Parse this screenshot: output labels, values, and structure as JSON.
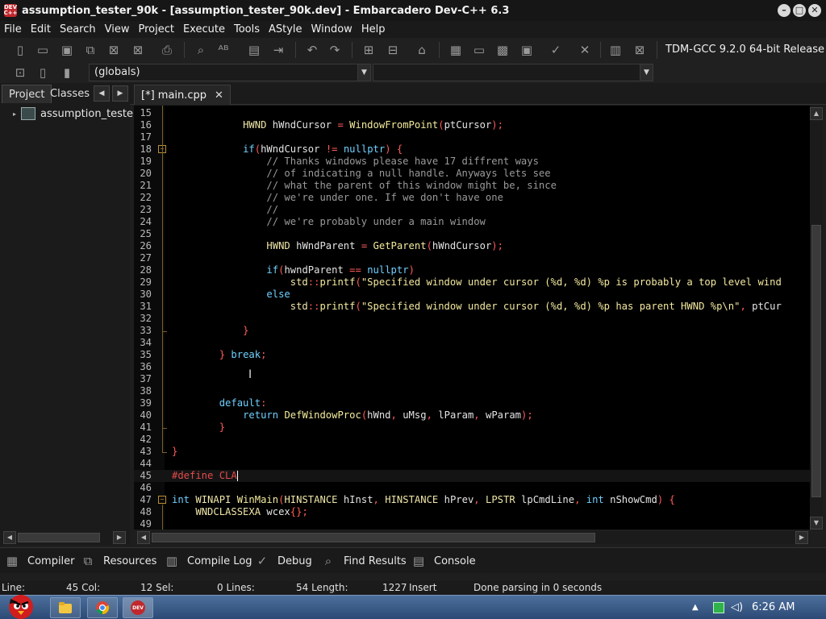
{
  "window": {
    "title": "assumption_tester_90k - [assumption_tester_90k.dev] - Embarcadero Dev-C++ 6.3",
    "app_icon_text": "DEV C++"
  },
  "menu": [
    "File",
    "Edit",
    "Search",
    "View",
    "Project",
    "Execute",
    "Tools",
    "AStyle",
    "Window",
    "Help"
  ],
  "toolbar": {
    "compiler": "TDM-GCC 9.2.0 64-bit Release",
    "scope_combo": "(globals)"
  },
  "left_panel": {
    "tabs": [
      "Project",
      "Classes"
    ],
    "active_tab": "Project",
    "tree_root": "assumption_tester"
  },
  "editor": {
    "tab_label": "[*] main.cpp",
    "close_glyph": "✕",
    "lines": [
      {
        "n": "15",
        "html": ""
      },
      {
        "n": "16",
        "html": "            <span class=\"t\">HWND</span> <span class=\"id\">hWndCursor</span> <span class=\"o\">=</span> <span class=\"f\">WindowFromPoint</span><span class=\"o\">(</span><span class=\"id\">ptCursor</span><span class=\"o\">);</span>"
      },
      {
        "n": "17",
        "html": ""
      },
      {
        "n": "18",
        "html": "            <span class=\"k\">if</span><span class=\"o\">(</span><span class=\"id\">hWndCursor</span> <span class=\"o\">!=</span> <span class=\"k\">nullptr</span><span class=\"o\">)</span> <span class=\"o\">{</span>"
      },
      {
        "n": "19",
        "html": "                <span class=\"c\">// Thanks windows please have 17 diffrent ways</span>"
      },
      {
        "n": "20",
        "html": "                <span class=\"c\">// of indicating a null handle. Anyways lets see</span>"
      },
      {
        "n": "21",
        "html": "                <span class=\"c\">// what the parent of this window might be, since</span>"
      },
      {
        "n": "22",
        "html": "                <span class=\"c\">// we're under one. If we don't have one</span>"
      },
      {
        "n": "23",
        "html": "                <span class=\"c\">//</span>"
      },
      {
        "n": "24",
        "html": "                <span class=\"c\">// we're probably under a main window</span>"
      },
      {
        "n": "25",
        "html": ""
      },
      {
        "n": "26",
        "html": "                <span class=\"t\">HWND</span> <span class=\"id\">hWndParent</span> <span class=\"o\">=</span> <span class=\"f\">GetParent</span><span class=\"o\">(</span><span class=\"id\">hWndCursor</span><span class=\"o\">);</span>"
      },
      {
        "n": "27",
        "html": ""
      },
      {
        "n": "28",
        "html": "                <span class=\"k\">if</span><span class=\"o\">(</span><span class=\"id\">hwndParent</span> <span class=\"o\">==</span> <span class=\"k\">nullptr</span><span class=\"o\">)</span>"
      },
      {
        "n": "29",
        "html": "                    <span class=\"t\">std</span><span class=\"o\">::</span><span class=\"f\">printf</span><span class=\"o\">(</span><span class=\"s\">\"Specified window under cursor (%d, %d) %p is probably a top level wind</span>"
      },
      {
        "n": "30",
        "html": "                <span class=\"k\">else</span>"
      },
      {
        "n": "31",
        "html": "                    <span class=\"t\">std</span><span class=\"o\">::</span><span class=\"f\">printf</span><span class=\"o\">(</span><span class=\"s\">\"Specified window under cursor (%d, %d) %p has parent HWND %p\\n\"</span><span class=\"o\">,</span> <span class=\"id\">ptCur</span>"
      },
      {
        "n": "32",
        "html": ""
      },
      {
        "n": "33",
        "html": "            <span class=\"o\">}</span>"
      },
      {
        "n": "34",
        "html": ""
      },
      {
        "n": "35",
        "html": "        <span class=\"o\">}</span> <span class=\"k\">break</span><span class=\"o\">;</span>"
      },
      {
        "n": "36",
        "html": ""
      },
      {
        "n": "37",
        "html": ""
      },
      {
        "n": "38",
        "html": ""
      },
      {
        "n": "39",
        "html": "        <span class=\"k\">default</span><span class=\"o\">:</span>"
      },
      {
        "n": "40",
        "html": "            <span class=\"k\">return</span> <span class=\"f\">DefWindowProc</span><span class=\"o\">(</span><span class=\"id\">hWnd</span><span class=\"o\">,</span> <span class=\"id\">uMsg</span><span class=\"o\">,</span> <span class=\"id\">lParam</span><span class=\"o\">,</span> <span class=\"id\">wParam</span><span class=\"o\">);</span>"
      },
      {
        "n": "41",
        "html": "        <span class=\"o\">}</span>"
      },
      {
        "n": "42",
        "html": ""
      },
      {
        "n": "43",
        "html": "<span class=\"o\">}</span>"
      },
      {
        "n": "44",
        "html": ""
      },
      {
        "n": "45",
        "html": "<span class=\"pp\">#define CLA</span><span class=\"cursor\"></span>"
      },
      {
        "n": "46",
        "html": ""
      },
      {
        "n": "47",
        "html": "<span class=\"k\">int</span> <span class=\"t\">WINAPI</span> <span class=\"f\">WinMain</span><span class=\"o\">(</span><span class=\"t\">HINSTANCE</span> <span class=\"id\">hInst</span><span class=\"o\">,</span> <span class=\"t\">HINSTANCE</span> <span class=\"id\">hPrev</span><span class=\"o\">,</span> <span class=\"t\">LPSTR</span> <span class=\"id\">lpCmdLine</span><span class=\"o\">,</span> <span class=\"k\">int</span> <span class=\"id\">nShowCmd</span><span class=\"o\">)</span> <span class=\"o\">{</span>"
      },
      {
        "n": "48",
        "html": "    <span class=\"t\">WNDCLASSEXA</span> <span class=\"id\">wcex</span><span class=\"o\">{};</span>"
      },
      {
        "n": "49",
        "html": ""
      }
    ],
    "current_line": "45"
  },
  "bottom_tabs": [
    {
      "label": "Compiler",
      "icon": "compiler-icon"
    },
    {
      "label": "Resources",
      "icon": "resources-icon"
    },
    {
      "label": "Compile Log",
      "icon": "compile-log-icon"
    },
    {
      "label": "Debug",
      "icon": "debug-check-icon"
    },
    {
      "label": "Find Results",
      "icon": "find-results-icon"
    },
    {
      "label": "Console",
      "icon": "console-icon"
    }
  ],
  "status": {
    "line": "Line:",
    "line_val": "45 Col:",
    "col_val": "12 Sel:",
    "sel_val": "0 Lines:",
    "lines_val": "54 Length:",
    "length_val": "1227",
    "mode": "Insert",
    "parse": "Done parsing in 0 seconds"
  },
  "taskbar": {
    "clock": "6:26 AM",
    "dev_icon_text": "DEV"
  }
}
